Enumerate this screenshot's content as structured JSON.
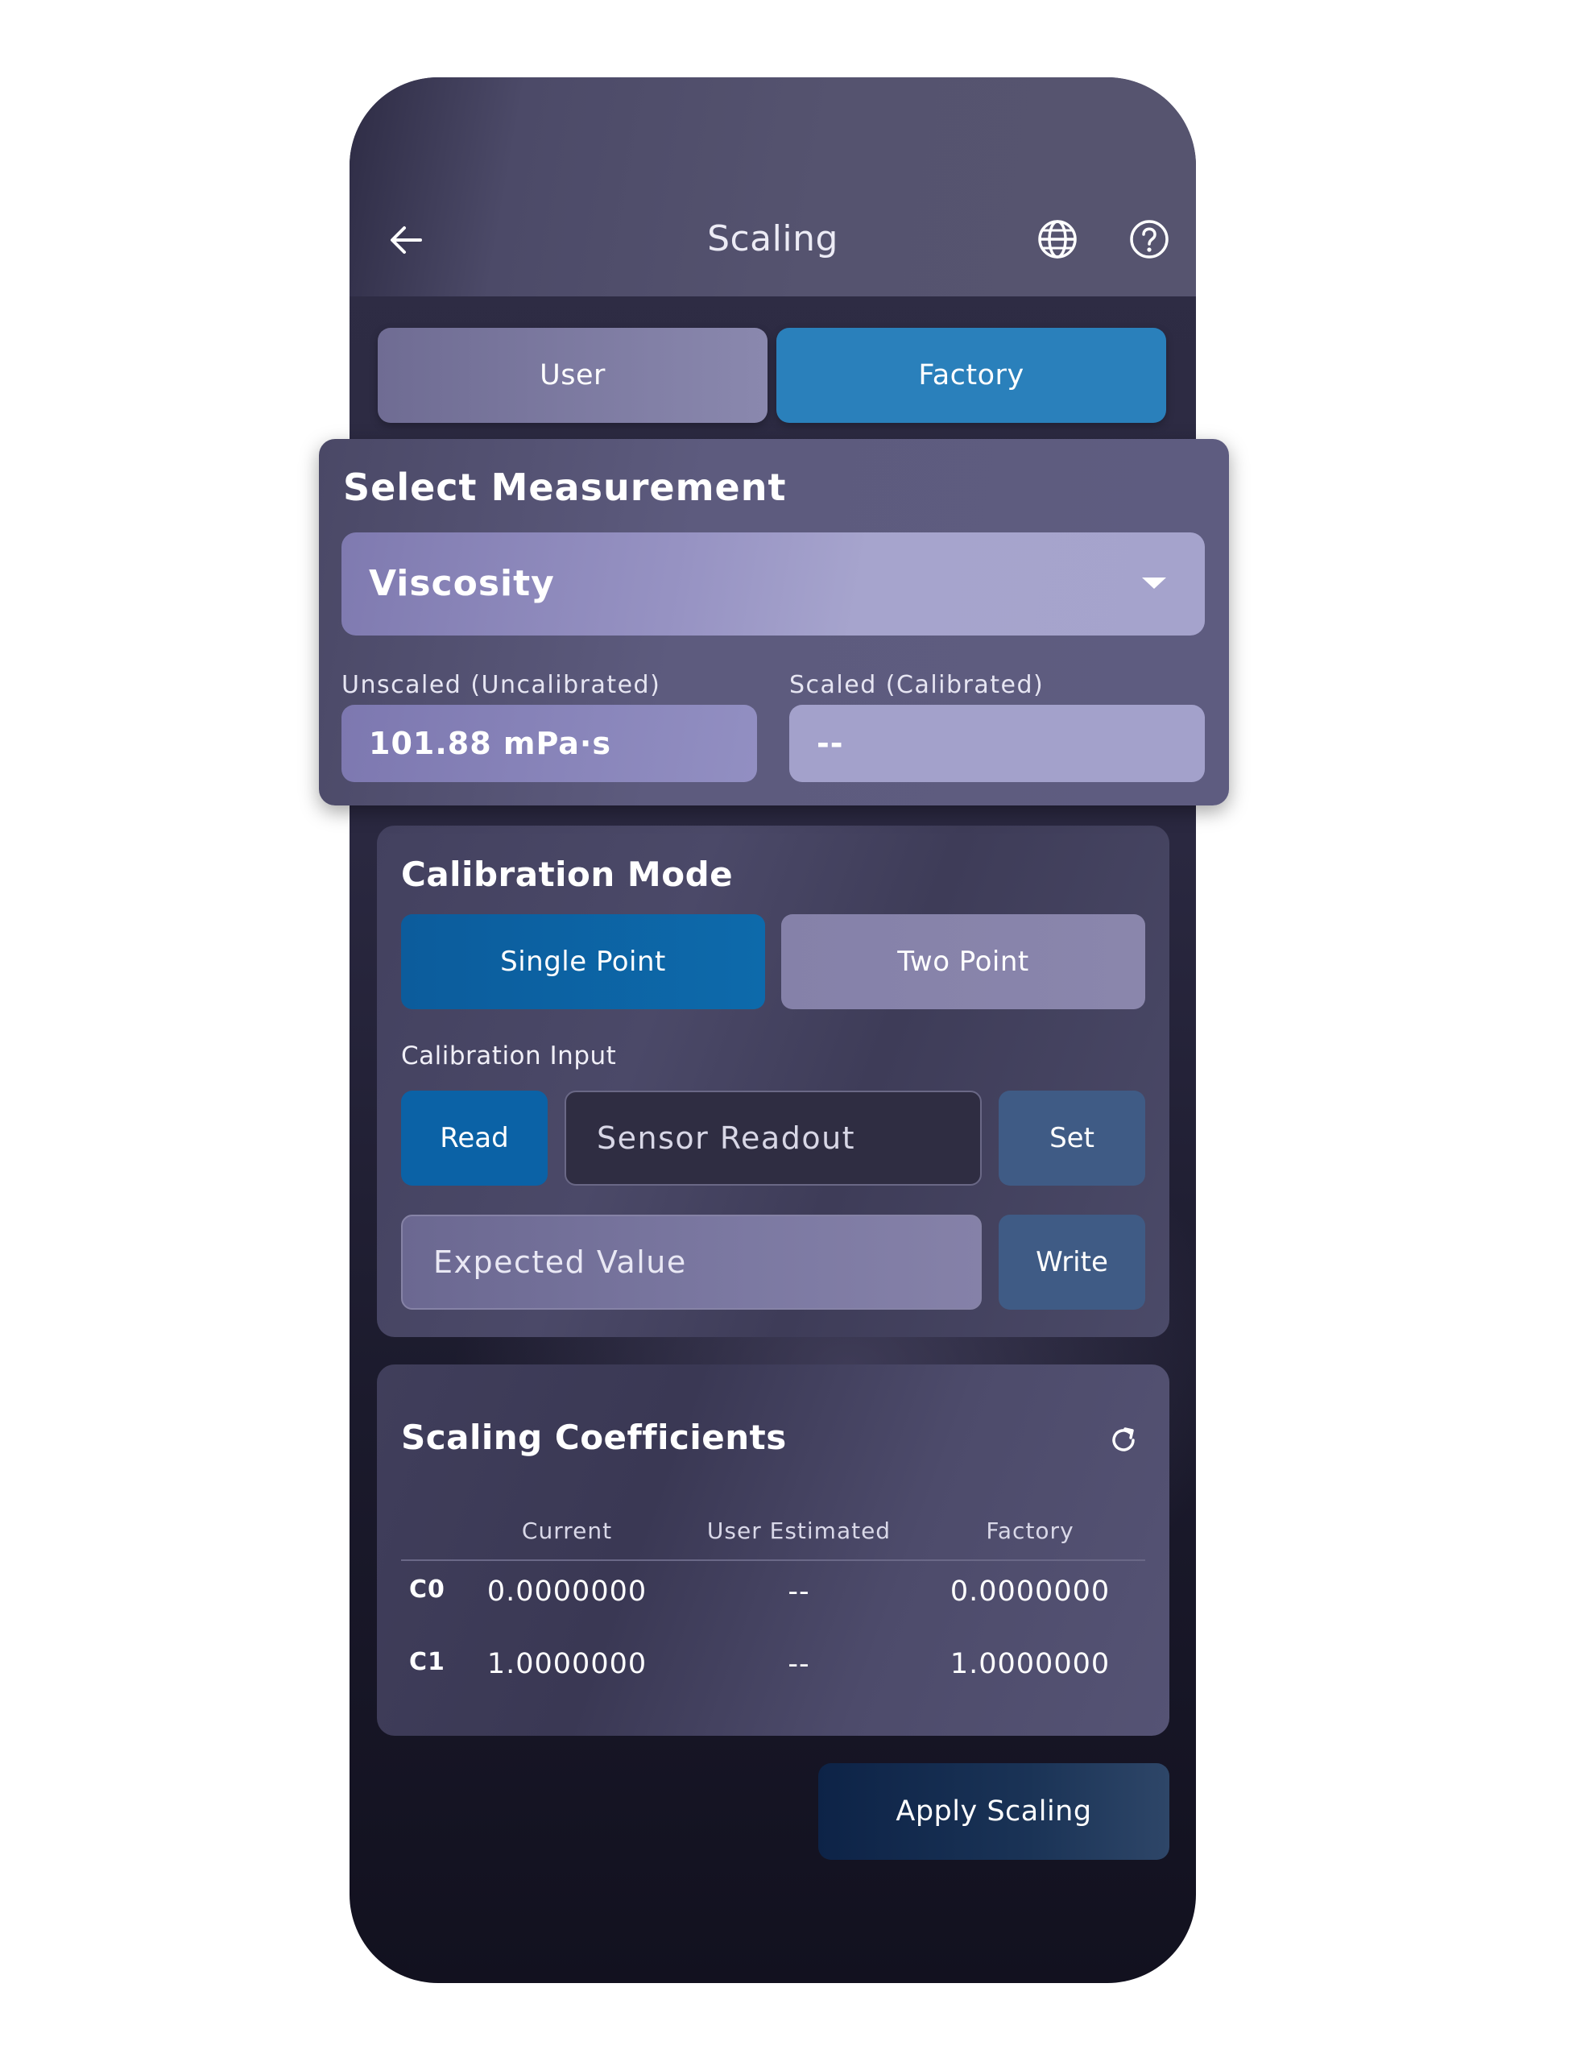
{
  "header": {
    "title": "Scaling",
    "back_icon": "arrow-left-icon",
    "globe_icon": "globe-icon",
    "help_icon": "help-circle-icon"
  },
  "tabs": [
    {
      "label": "User",
      "active": false
    },
    {
      "label": "Factory",
      "active": true
    }
  ],
  "measurement": {
    "title": "Select Measurement",
    "selected": "Viscosity",
    "unscaled_label": "Unscaled (Uncalibrated)",
    "unscaled_value": "101.88 mPa·s",
    "scaled_label": "Scaled (Calibrated)",
    "scaled_value": "--"
  },
  "calibration": {
    "title": "Calibration Mode",
    "modes": [
      {
        "label": "Single Point",
        "active": true
      },
      {
        "label": "Two Point",
        "active": false
      }
    ],
    "input_label": "Calibration Input",
    "read_label": "Read",
    "sensor_placeholder": "Sensor Readout",
    "set_label": "Set",
    "expected_placeholder": "Expected Value",
    "write_label": "Write"
  },
  "coefficients": {
    "title": "Scaling Coefficients",
    "refresh_icon": "refresh-icon",
    "columns": [
      "",
      "Current",
      "User Estimated",
      "Factory"
    ],
    "rows": [
      {
        "name": "C0",
        "current": "0.0000000",
        "user_estimated": "--",
        "factory": "0.0000000"
      },
      {
        "name": "C1",
        "current": "1.0000000",
        "user_estimated": "--",
        "factory": "1.0000000"
      }
    ]
  },
  "apply_label": "Apply Scaling",
  "colors": {
    "accent_blue": "#2a80bb",
    "active_mode": "#0d6aab",
    "secondary_button": "#3f5b85",
    "apply_button": "#0d2347"
  }
}
